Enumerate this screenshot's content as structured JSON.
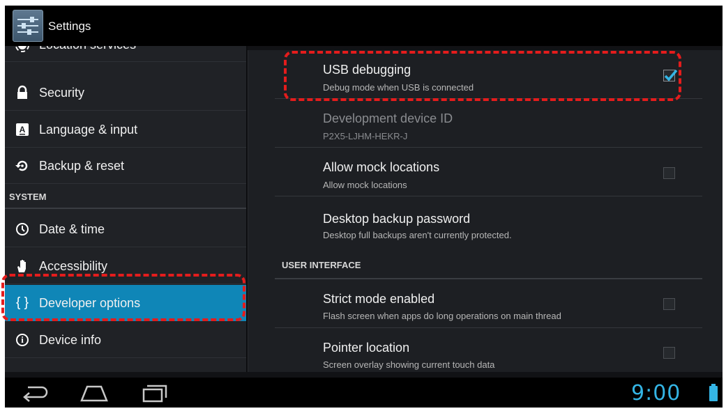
{
  "app": {
    "title": "Settings"
  },
  "sidebar": {
    "items": [
      {
        "label": "Location services",
        "icon": "location-icon"
      },
      {
        "label": "Security",
        "icon": "lock-icon"
      },
      {
        "label": "Language & input",
        "icon": "keyboard-a-icon"
      },
      {
        "label": "Backup & reset",
        "icon": "backup-icon"
      },
      {
        "label": "Date & time",
        "icon": "clock-icon"
      },
      {
        "label": "Accessibility",
        "icon": "hand-icon"
      },
      {
        "label": "Developer options",
        "icon": "braces-icon",
        "glyph": "{ }"
      },
      {
        "label": "Device info",
        "icon": "info-icon",
        "glyph": "i"
      }
    ],
    "section_header": "SYSTEM",
    "active": "Developer options"
  },
  "main": {
    "items": [
      {
        "title": "USB debugging",
        "summary": "Debug mode when USB is connected",
        "checked": true
      },
      {
        "title": "Development device ID",
        "summary": "P2X5-LJHM-HEKR-J",
        "disabled": true
      },
      {
        "title": "Allow mock locations",
        "summary": "Allow mock locations",
        "checked": false
      },
      {
        "title": "Desktop backup password",
        "summary": "Desktop full backups aren't currently protected."
      },
      {
        "title": "Strict mode enabled",
        "summary": "Flash screen when apps do long operations on main thread",
        "checked": false
      },
      {
        "title": "Pointer location",
        "summary": "Screen overlay showing current touch data",
        "checked": false
      }
    ],
    "section_header": "USER INTERFACE"
  },
  "statusbar": {
    "time": "9:00"
  },
  "colors": {
    "accent": "#34b5e5",
    "selected": "#0f86b7",
    "annotation": "#e41c1c"
  }
}
